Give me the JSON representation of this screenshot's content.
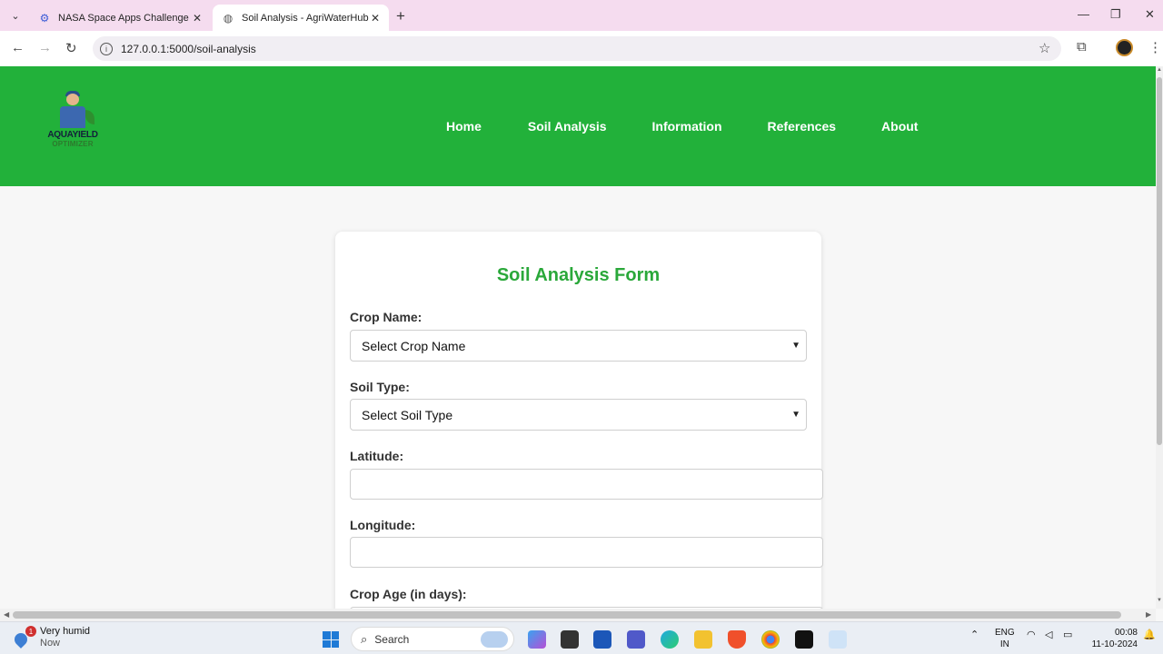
{
  "browser": {
    "tabs": [
      {
        "title": "NASA Space Apps Challenge",
        "active": false
      },
      {
        "title": "Soil Analysis - AgriWaterHub",
        "active": true
      }
    ],
    "url": "127.0.0.1:5000/soil-analysis"
  },
  "site": {
    "logo": {
      "line1": "AQUAYIELD",
      "line2": "OPTIMIZER"
    },
    "nav": [
      "Home",
      "Soil Analysis",
      "Information",
      "References",
      "About"
    ],
    "colors": {
      "header": "#22b13a",
      "title": "#2aa83a"
    }
  },
  "form": {
    "title": "Soil Analysis Form",
    "crop_label": "Crop Name:",
    "crop_select": "Select Crop Name",
    "soil_label": "Soil Type:",
    "soil_select": "Select Soil Type",
    "latitude_label": "Latitude:",
    "latitude_value": "",
    "longitude_label": "Longitude:",
    "longitude_value": "",
    "crop_age_label": "Crop Age (in days):"
  },
  "taskbar": {
    "weather": {
      "title": "Very humid",
      "sub": "Now",
      "badge": "1"
    },
    "search_placeholder": "Search",
    "lang": {
      "line1": "ENG",
      "line2": "IN"
    },
    "time": "00:08",
    "date": "11-10-2024"
  }
}
